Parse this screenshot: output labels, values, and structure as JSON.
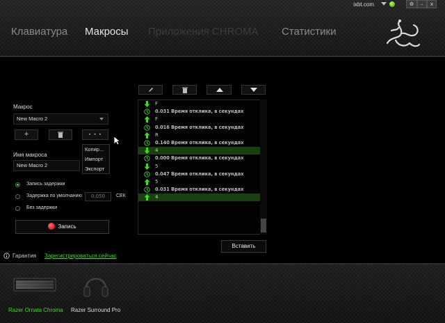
{
  "header": {
    "tabs": [
      {
        "label": "Клавиатура"
      },
      {
        "label": "Макросы"
      },
      {
        "label": "Приложения CHROMA"
      },
      {
        "label": "Статистики"
      }
    ],
    "account": "ixbt.com",
    "window_buttons": [
      "⚙",
      "–",
      "x"
    ]
  },
  "left": {
    "macro_label": "Макрос",
    "macro_select": "New Macro 2",
    "add_btn": "+",
    "delete_btn_icon": "trash-icon",
    "more_btn": "• • •",
    "menu": [
      "Копир...",
      "Импорт",
      "Экспорт"
    ],
    "name_label": "Имя макроса",
    "name_value": "New Macro 2",
    "delay_options": [
      {
        "label": "Запись задержки",
        "selected": true
      },
      {
        "label": "Задержка по умолчанию",
        "selected": false
      },
      {
        "label": "Без задержки",
        "selected": false
      }
    ],
    "default_delay_value": "0.050",
    "unit": "СЕК",
    "record_btn": "Запись"
  },
  "editor": {
    "toolbar_icons": [
      "pencil-icon",
      "trash-icon",
      "arrow-up-icon",
      "arrow-down-icon"
    ],
    "events": [
      {
        "type": "down",
        "text": "F"
      },
      {
        "type": "delay",
        "text": "0.031 Время отклика, в секундах"
      },
      {
        "type": "up",
        "text": "F"
      },
      {
        "type": "delay",
        "text": "0.016 Время отклика, в секундах"
      },
      {
        "type": "up",
        "text": "R"
      },
      {
        "type": "delay",
        "text": "0.140 Время отклика, в секундах"
      },
      {
        "type": "down",
        "text": "4",
        "selected": true
      },
      {
        "type": "delay",
        "text": "0.000 Время отклика, в секундах"
      },
      {
        "type": "down",
        "text": "5"
      },
      {
        "type": "delay",
        "text": "0.047 Время отклика, в секундах"
      },
      {
        "type": "up",
        "text": "5"
      },
      {
        "type": "delay",
        "text": "0.031 Время отклика, в секундах"
      },
      {
        "type": "up",
        "text": "4",
        "selected": true
      }
    ],
    "insert_btn": "Вставить"
  },
  "footer": {
    "warranty": "Гарантия",
    "register_link": "Зарегистрироваться сейчас",
    "devices": [
      {
        "name": "Razer Ornata Chroma",
        "active": true
      },
      {
        "name": "Razer Surround Pro",
        "active": false
      }
    ]
  },
  "colors": {
    "accent": "#44d62c",
    "selected_row": "#1a4012",
    "record": "#d00000"
  }
}
